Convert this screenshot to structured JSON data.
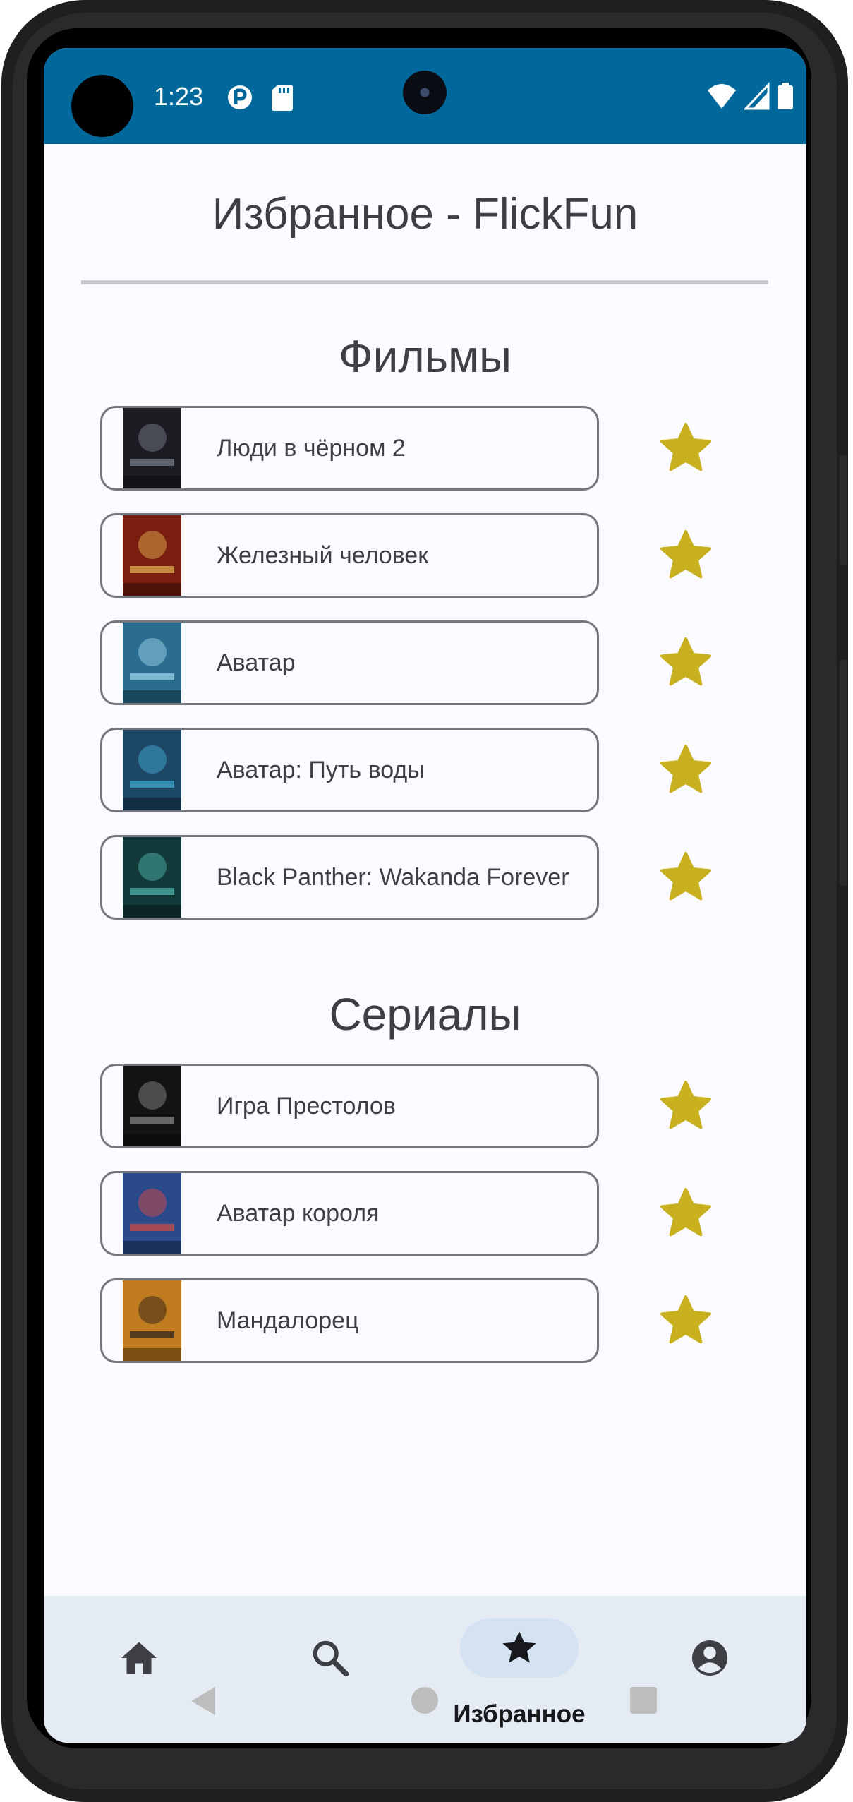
{
  "status_bar": {
    "time": "1:23",
    "left_icons": [
      "data-saver-icon",
      "sd-card-icon"
    ],
    "right_icons": [
      "wifi-icon",
      "cellular-signal-icon",
      "battery-icon"
    ]
  },
  "header": {
    "title": "Избранное - FlickFun"
  },
  "movies": {
    "title": "Фильмы",
    "items": [
      {
        "label": "Люди в чёрном 2",
        "poster_color": "#1c1c22",
        "accent": "#6d7380"
      },
      {
        "label": "Железный человек",
        "poster_color": "#7a1e10",
        "accent": "#d9a34a"
      },
      {
        "label": "Аватар",
        "poster_color": "#2a6d8e",
        "accent": "#8fc8e0"
      },
      {
        "label": "Аватар: Путь воды",
        "poster_color": "#1c4866",
        "accent": "#3fa0c8"
      },
      {
        "label": "Black Panther: Wakanda Forever",
        "poster_color": "#123a3a",
        "accent": "#4aa6a0"
      }
    ]
  },
  "series": {
    "title": "Сериалы",
    "items": [
      {
        "label": "Игра Престолов",
        "poster_color": "#141414",
        "accent": "#7a7a7a"
      },
      {
        "label": "Аватар короля",
        "poster_color": "#2a4a8a",
        "accent": "#c34a4a"
      },
      {
        "label": "Мандалорец",
        "poster_color": "#c07a20",
        "accent": "#3a2a1a"
      }
    ]
  },
  "favorite_icon": "star-icon",
  "colors": {
    "status_bar": "#00689b",
    "star": "#c8b01e",
    "text": "#3d3f44",
    "nav_bg": "#e5ebf3",
    "nav_pill": "#d4e2f4"
  },
  "bottom_nav": {
    "items": [
      {
        "icon": "home-icon",
        "label": ""
      },
      {
        "icon": "search-icon",
        "label": ""
      },
      {
        "icon": "star-icon",
        "label": "Избранное",
        "active": true
      },
      {
        "icon": "account-icon",
        "label": ""
      }
    ]
  },
  "system_nav": [
    "back-icon",
    "home-circle-icon",
    "recents-icon"
  ]
}
